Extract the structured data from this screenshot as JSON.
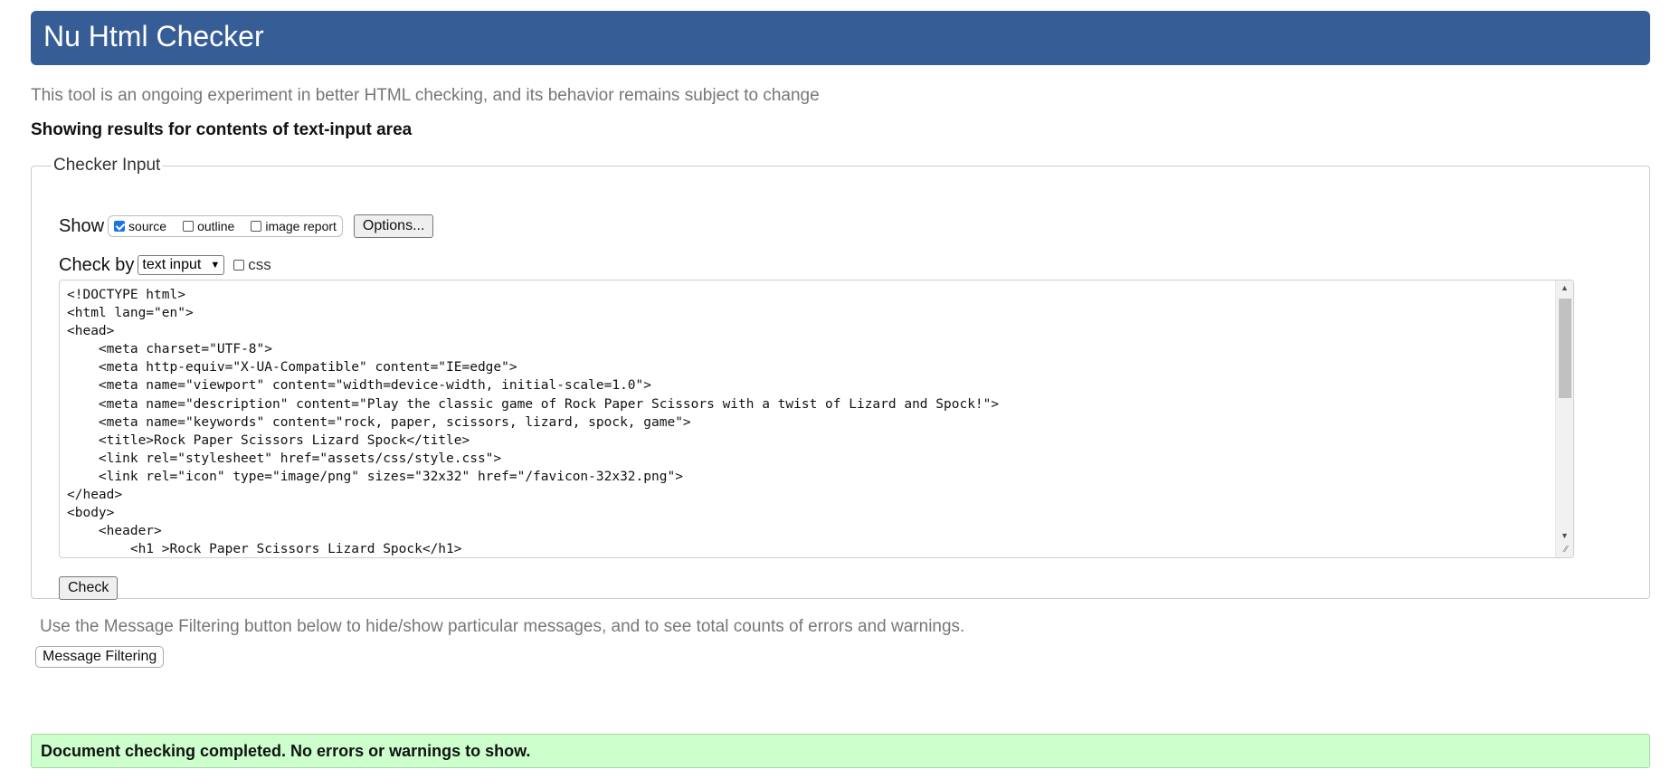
{
  "header": {
    "title": "Nu Html Checker"
  },
  "intro_text": "This tool is an ongoing experiment in better HTML checking, and its behavior remains subject to change",
  "results_heading": "Showing results for contents of text-input area",
  "checker": {
    "legend": "Checker Input",
    "show_label": "Show",
    "show_options": [
      {
        "label": "source",
        "checked": true
      },
      {
        "label": "outline",
        "checked": false
      },
      {
        "label": "image report",
        "checked": false
      }
    ],
    "options_button": "Options...",
    "check_by_label": "Check by",
    "check_by_value": "text input",
    "css_label": "css",
    "css_checked": false,
    "source_text": "<!DOCTYPE html>\n<html lang=\"en\">\n<head>\n    <meta charset=\"UTF-8\">\n    <meta http-equiv=\"X-UA-Compatible\" content=\"IE=edge\">\n    <meta name=\"viewport\" content=\"width=device-width, initial-scale=1.0\">\n    <meta name=\"description\" content=\"Play the classic game of Rock Paper Scissors with a twist of Lizard and Spock!\">\n    <meta name=\"keywords\" content=\"rock, paper, scissors, lizard, spock, game\">\n    <title>Rock Paper Scissors Lizard Spock</title>\n    <link rel=\"stylesheet\" href=\"assets/css/style.css\">\n    <link rel=\"icon\" type=\"image/png\" sizes=\"32x32\" href=\"/favicon-32x32.png\">\n</head>\n<body>\n    <header>\n        <h1 >Rock Paper Scissors Lizard Spock</h1>",
    "check_button": "Check"
  },
  "filter_note": "Use the Message Filtering button below to hide/show particular messages, and to see total counts of errors and warnings.",
  "filter_button": "Message Filtering",
  "success_message": "Document checking completed. No errors or warnings to show.",
  "colors": {
    "banner": "#365d95",
    "success_bg": "#ccffcc",
    "muted_text": "#777777"
  }
}
